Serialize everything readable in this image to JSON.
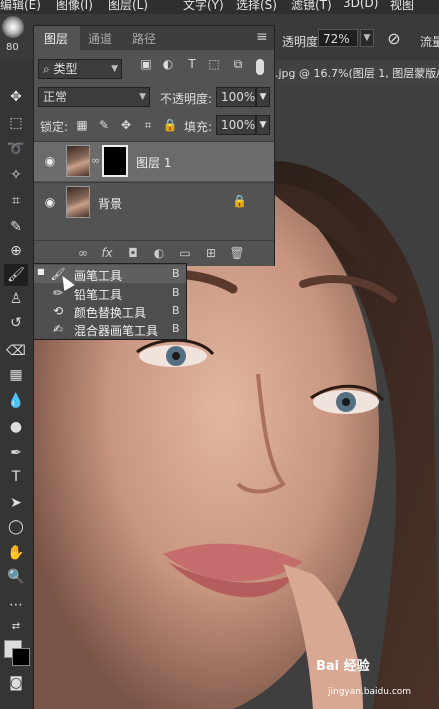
{
  "menubar": {
    "items": [
      "编辑(E)",
      "图像(I)",
      "图层(L)",
      "文字(Y)",
      "选择(S)",
      "滤镜(T)",
      "3D(D)",
      "视图"
    ]
  },
  "options": {
    "brush_size": "80",
    "opacity_label": "透明度:",
    "opacity_value": "72%",
    "flow_label": "流量"
  },
  "document_tab": {
    "title": ".jpg @ 16.7%(图层 1, 图层蒙版/"
  },
  "layers_panel": {
    "tabs": [
      "图层",
      "通道",
      "路径"
    ],
    "filter_kind": "类型",
    "blend_mode": "正常",
    "opacity_label": "不透明度:",
    "opacity_value": "100%",
    "lock_label": "锁定:",
    "fill_label": "填充:",
    "fill_value": "100%",
    "layers": [
      {
        "name": "图层 1",
        "has_mask": true,
        "selected": true
      },
      {
        "name": "背景",
        "locked": true,
        "selected": false
      }
    ],
    "footer_fx": "fx"
  },
  "tool_flyout": {
    "items": [
      {
        "label": "画笔工具",
        "key": "B",
        "icon": "brush-icon",
        "selected": true
      },
      {
        "label": "铅笔工具",
        "key": "B",
        "icon": "pencil-icon"
      },
      {
        "label": "颜色替换工具",
        "key": "B",
        "icon": "color-replace-icon"
      },
      {
        "label": "混合器画笔工具",
        "key": "B",
        "icon": "mixer-brush-icon"
      }
    ]
  },
  "watermark": {
    "brand": "Bai 经验",
    "url": "jingyan.baidu.com"
  },
  "colors": {
    "panel_bg": "#535353",
    "toolbar_bg": "#353535",
    "selected_row": "#6b6b6b"
  }
}
